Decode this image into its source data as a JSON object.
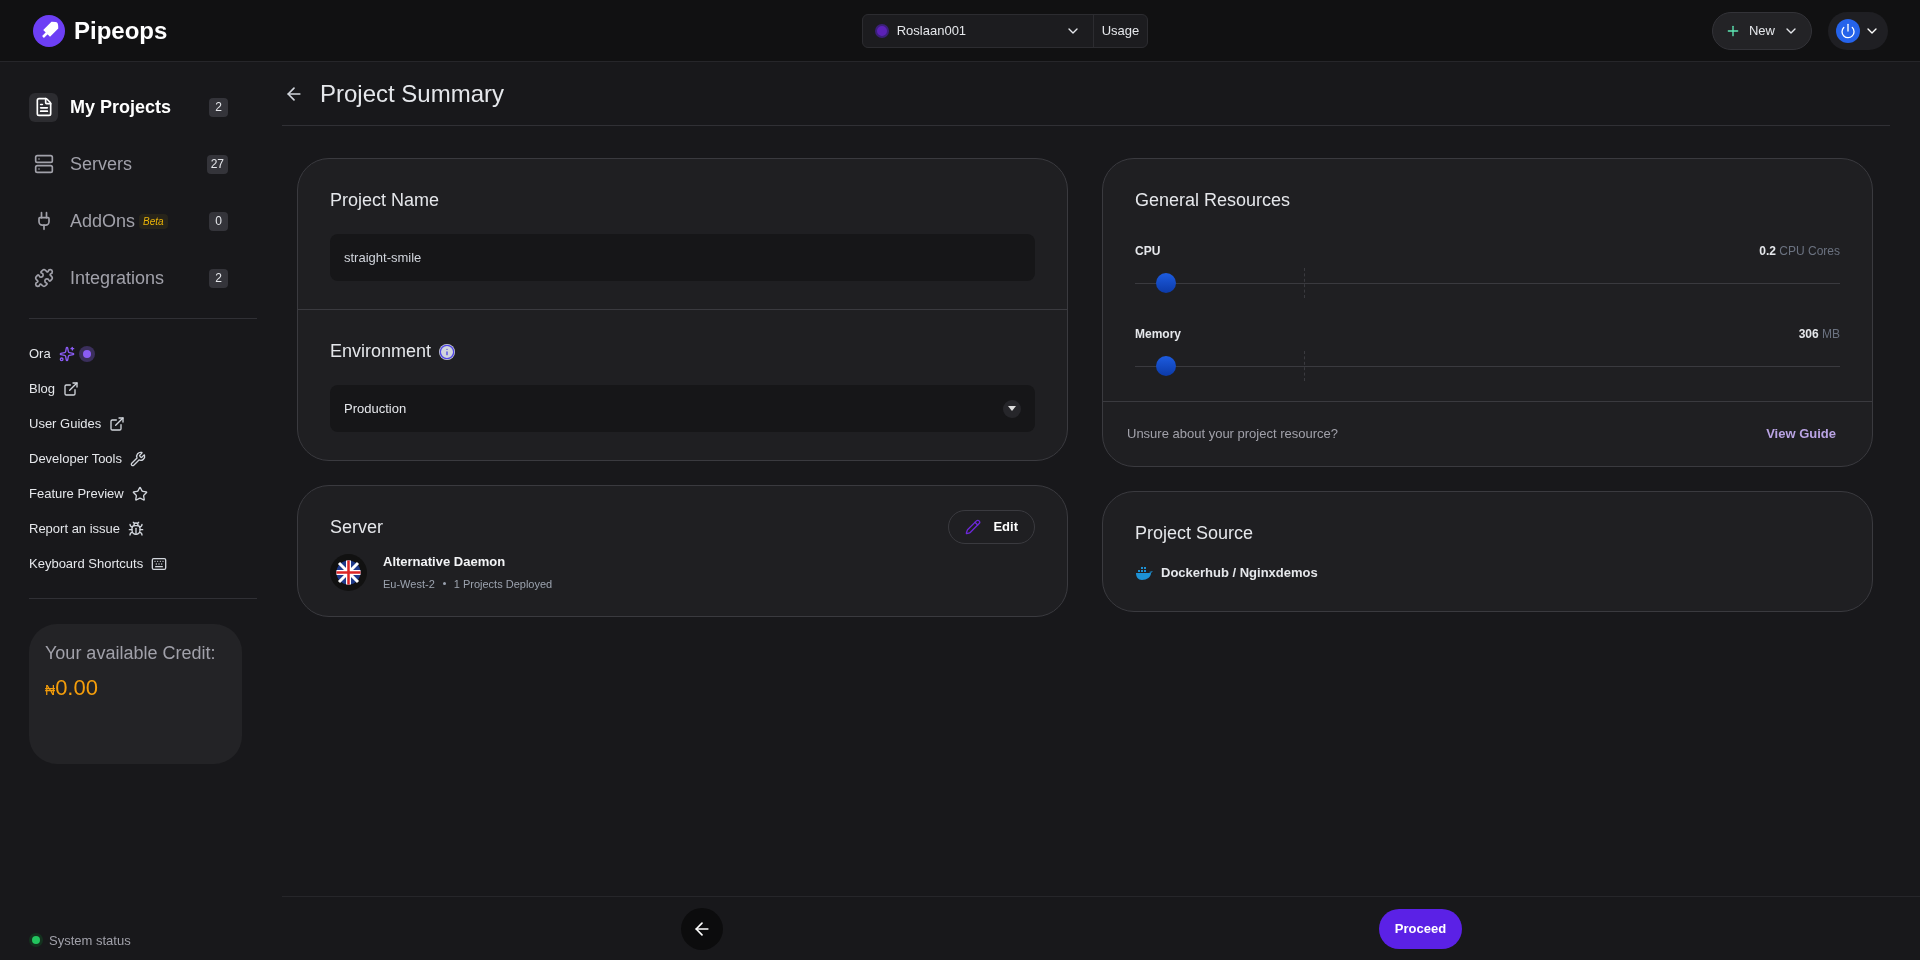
{
  "header": {
    "logo": "Pipeops",
    "workspace": "Roslaan001",
    "usage": "Usage",
    "new_button": "New"
  },
  "sidebar": {
    "nav": [
      {
        "label": "My Projects",
        "count": "2",
        "selected": true
      },
      {
        "label": "Servers",
        "count": "27",
        "selected": false
      },
      {
        "label": "AddOns",
        "badge": "Beta",
        "count": "0",
        "selected": false
      },
      {
        "label": "Integrations",
        "count": "2",
        "selected": false
      }
    ],
    "links": [
      {
        "label": "Ora"
      },
      {
        "label": "Blog"
      },
      {
        "label": "User Guides"
      },
      {
        "label": "Developer Tools"
      },
      {
        "label": "Feature Preview"
      },
      {
        "label": "Report an issue"
      },
      {
        "label": "Keyboard Shortcuts"
      }
    ],
    "credit": {
      "label": "Your available Credit:",
      "currency": "₦",
      "amount": "0.00"
    },
    "status": "System status"
  },
  "page_title": "Project Summary",
  "project_name": {
    "title": "Project Name",
    "value": "straight-smile"
  },
  "environment": {
    "title": "Environment",
    "value": "Production"
  },
  "server": {
    "title": "Server",
    "edit": "Edit",
    "name": "Alternative Daemon",
    "region": "Eu-West-2",
    "deployed": "1 Projects Deployed"
  },
  "resources": {
    "title": "General Resources",
    "sliders": [
      {
        "label": "CPU",
        "value": "0.2",
        "unit": "CPU Cores",
        "level": 0.03
      },
      {
        "label": "Memory",
        "value": "306",
        "unit": "MB",
        "level": 0.03
      }
    ],
    "hint": "Unsure about your project resource?",
    "guide": "View Guide"
  },
  "source": {
    "title": "Project Source",
    "value": "Dockerhub / Nginxdemos"
  },
  "footer": {
    "proceed": "Proceed"
  }
}
